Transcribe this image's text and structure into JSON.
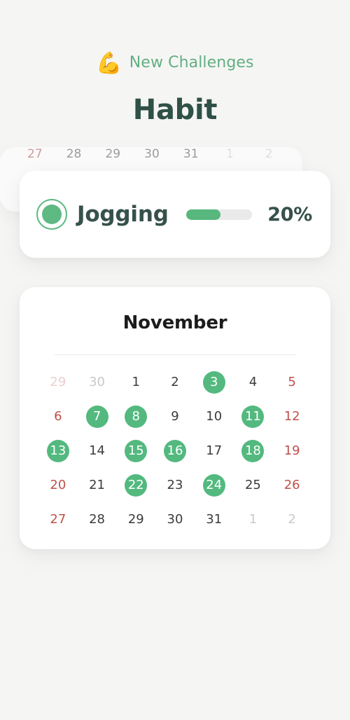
{
  "header": {
    "eyebrow_emoji": "💪",
    "eyebrow_emoji_name": "flexed-biceps-emoji",
    "eyebrow_text": "New Challenges",
    "title": "Habit"
  },
  "habit_card": {
    "status_icon": "filled-circle-ring-icon",
    "name": "Jogging",
    "progress_percent_label": "20%",
    "progress_fill_percent": 52
  },
  "calendar": {
    "month": "November",
    "weeks": [
      [
        {
          "label": "29",
          "marked": false,
          "other_month": true,
          "weekend": true
        },
        {
          "label": "30",
          "marked": false,
          "other_month": true,
          "weekend": false
        },
        {
          "label": "1",
          "marked": false,
          "other_month": false,
          "weekend": false
        },
        {
          "label": "2",
          "marked": false,
          "other_month": false,
          "weekend": false
        },
        {
          "label": "3",
          "marked": true,
          "other_month": false,
          "weekend": false
        },
        {
          "label": "4",
          "marked": false,
          "other_month": false,
          "weekend": false
        },
        {
          "label": "5",
          "marked": false,
          "other_month": false,
          "weekend": true
        }
      ],
      [
        {
          "label": "6",
          "marked": false,
          "other_month": false,
          "weekend": true
        },
        {
          "label": "7",
          "marked": true,
          "other_month": false,
          "weekend": false
        },
        {
          "label": "8",
          "marked": true,
          "other_month": false,
          "weekend": false
        },
        {
          "label": "9",
          "marked": false,
          "other_month": false,
          "weekend": false
        },
        {
          "label": "10",
          "marked": false,
          "other_month": false,
          "weekend": false
        },
        {
          "label": "11",
          "marked": true,
          "other_month": false,
          "weekend": false
        },
        {
          "label": "12",
          "marked": false,
          "other_month": false,
          "weekend": true
        }
      ],
      [
        {
          "label": "13",
          "marked": true,
          "other_month": false,
          "weekend": true
        },
        {
          "label": "14",
          "marked": false,
          "other_month": false,
          "weekend": false
        },
        {
          "label": "15",
          "marked": true,
          "other_month": false,
          "weekend": false
        },
        {
          "label": "16",
          "marked": true,
          "other_month": false,
          "weekend": false
        },
        {
          "label": "17",
          "marked": false,
          "other_month": false,
          "weekend": false
        },
        {
          "label": "18",
          "marked": true,
          "other_month": false,
          "weekend": false
        },
        {
          "label": "19",
          "marked": false,
          "other_month": false,
          "weekend": true
        }
      ],
      [
        {
          "label": "20",
          "marked": false,
          "other_month": false,
          "weekend": true
        },
        {
          "label": "21",
          "marked": false,
          "other_month": false,
          "weekend": false
        },
        {
          "label": "22",
          "marked": true,
          "other_month": false,
          "weekend": false
        },
        {
          "label": "23",
          "marked": false,
          "other_month": false,
          "weekend": false
        },
        {
          "label": "24",
          "marked": true,
          "other_month": false,
          "weekend": false
        },
        {
          "label": "25",
          "marked": false,
          "other_month": false,
          "weekend": false
        },
        {
          "label": "26",
          "marked": false,
          "other_month": false,
          "weekend": true
        }
      ],
      [
        {
          "label": "27",
          "marked": false,
          "other_month": false,
          "weekend": true
        },
        {
          "label": "28",
          "marked": false,
          "other_month": false,
          "weekend": false
        },
        {
          "label": "29",
          "marked": false,
          "other_month": false,
          "weekend": false
        },
        {
          "label": "30",
          "marked": false,
          "other_month": false,
          "weekend": false
        },
        {
          "label": "31",
          "marked": false,
          "other_month": false,
          "weekend": false
        },
        {
          "label": "1",
          "marked": false,
          "other_month": true,
          "weekend": false
        },
        {
          "label": "2",
          "marked": false,
          "other_month": true,
          "weekend": false
        }
      ]
    ]
  },
  "calendar_ghost": {
    "row": [
      {
        "label": "27",
        "other_month": false,
        "weekend": true
      },
      {
        "label": "28",
        "other_month": false,
        "weekend": false
      },
      {
        "label": "29",
        "other_month": false,
        "weekend": false
      },
      {
        "label": "30",
        "other_month": false,
        "weekend": false
      },
      {
        "label": "31",
        "other_month": false,
        "weekend": false
      },
      {
        "label": "1",
        "other_month": true,
        "weekend": false
      },
      {
        "label": "2",
        "other_month": true,
        "weekend": false
      }
    ]
  },
  "colors": {
    "background": "#f5f5f4",
    "card": "#ffffff",
    "accent_green": "#53b97f",
    "eyebrow_green": "#62af81",
    "title_dark_green": "#2f5147",
    "weekend_red": "#c0504a",
    "muted_gray": "#c9c9c9"
  }
}
